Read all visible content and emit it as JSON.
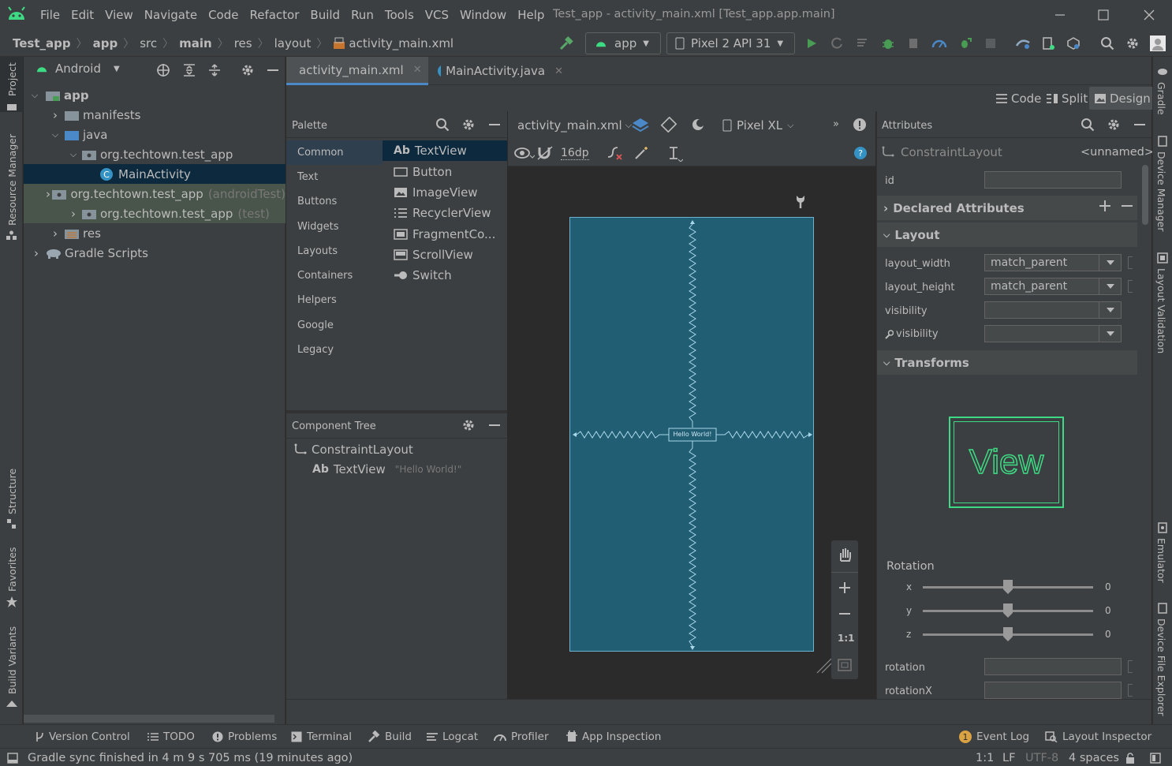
{
  "menu": [
    "File",
    "Edit",
    "View",
    "Navigate",
    "Code",
    "Refactor",
    "Build",
    "Run",
    "Tools",
    "VCS",
    "Window",
    "Help"
  ],
  "window_title": "Test_app - activity_main.xml [Test_app.app.main]",
  "breadcrumbs": [
    "Test_app",
    "app",
    "src",
    "main",
    "res",
    "layout",
    "activity_main.xml"
  ],
  "run_config": "app",
  "device_select": "Pixel 2 API 31",
  "project_view": "Android",
  "tree": [
    {
      "label": "app",
      "bold": true
    },
    {
      "label": "manifests"
    },
    {
      "label": "java"
    },
    {
      "label": "org.techtown.test_app"
    },
    {
      "label": "MainActivity"
    },
    {
      "label": "org.techtown.test_app",
      "suffix": "(androidTest)"
    },
    {
      "label": "org.techtown.test_app",
      "suffix": "(test)"
    },
    {
      "label": "res"
    },
    {
      "label": "Gradle Scripts"
    }
  ],
  "left_stripe": [
    "Project",
    "Resource Manager",
    "Structure",
    "Favorites",
    "Build Variants"
  ],
  "right_stripe": [
    "Gradle",
    "Device Manager",
    "Layout Validation",
    "Emulator",
    "Device File Explorer"
  ],
  "tabs": [
    "activity_main.xml",
    "MainActivity.java"
  ],
  "view_modes": [
    "Code",
    "Split",
    "Design"
  ],
  "palette": {
    "title": "Palette",
    "categories": [
      "Common",
      "Text",
      "Buttons",
      "Widgets",
      "Layouts",
      "Containers",
      "Helpers",
      "Google",
      "Legacy"
    ],
    "items": [
      "TextView",
      "Button",
      "ImageView",
      "RecyclerView",
      "FragmentCo...",
      "ScrollView",
      "Switch"
    ]
  },
  "component_tree": {
    "title": "Component Tree",
    "root": "ConstraintLayout",
    "child": "TextView",
    "child_text": "\"Hello World!\""
  },
  "design": {
    "file": "activity_main.xml",
    "device": "Pixel XL",
    "margin": "16dp",
    "hello_text": "Hello World!",
    "zoom_fit": "1:1"
  },
  "attributes": {
    "title": "Attributes",
    "component": "ConstraintLayout",
    "name": "<unnamed>",
    "id_label": "id",
    "declared": "Declared Attributes",
    "layout": "Layout",
    "layout_width_label": "layout_width",
    "layout_width": "match_parent",
    "layout_height_label": "layout_height",
    "layout_height": "match_parent",
    "visibility_label": "visibility",
    "tools_visibility_label": "visibility",
    "transforms": "Transforms",
    "view_preview": "View",
    "rotation_label": "Rotation",
    "axes": [
      {
        "name": "x",
        "value": "0",
        "level": 0.5
      },
      {
        "name": "y",
        "value": "0",
        "level": 0.5
      },
      {
        "name": "z",
        "value": "0",
        "level": 0.5
      }
    ],
    "rotation_field": "rotation",
    "rotationX_field": "rotationX"
  },
  "bottom_tools": [
    "Version Control",
    "TODO",
    "Problems",
    "Terminal",
    "Build",
    "Logcat",
    "Profiler",
    "App Inspection"
  ],
  "bottom_right_tools": [
    "Event Log",
    "Layout Inspector"
  ],
  "event_count": "1",
  "status": {
    "message": "Gradle sync finished in 4 m 9 s 705 ms (19 minutes ago)",
    "position": "1:1",
    "line_sep": "LF",
    "encoding": "UTF-8",
    "indent": "4 spaces"
  },
  "colors": {
    "background": "#2b2b2b",
    "panel": "#3c3f41",
    "selection": "#0d293e",
    "accent": "#4a88c7",
    "device_blueprint": "#215d73",
    "android_green": "#3ddc84"
  }
}
